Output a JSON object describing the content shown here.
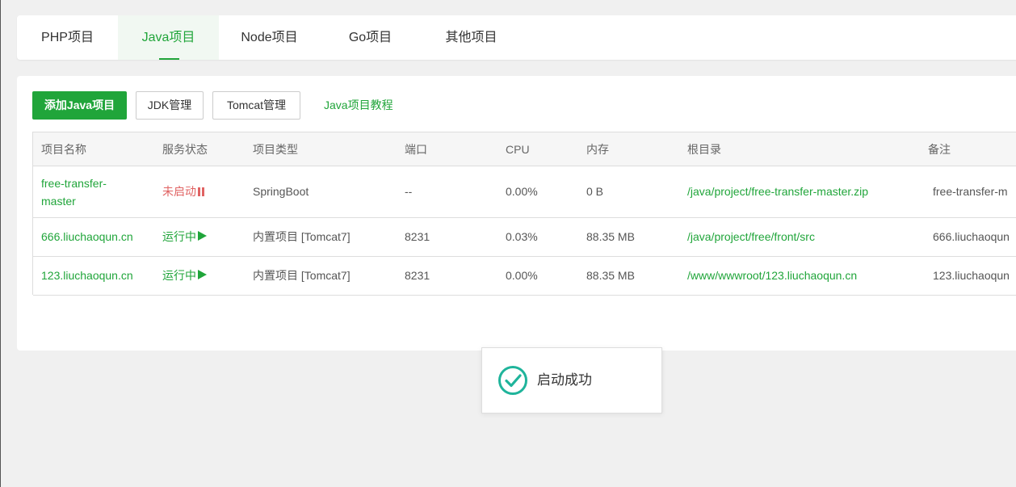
{
  "tabs": [
    {
      "label": "PHP项目",
      "active": false
    },
    {
      "label": "Java项目",
      "active": true
    },
    {
      "label": "Node项目",
      "active": false
    },
    {
      "label": "Go项目",
      "active": false
    },
    {
      "label": "其他项目",
      "active": false
    }
  ],
  "toolbar": {
    "add_label": "添加Java项目",
    "jdk_label": "JDK管理",
    "tomcat_label": "Tomcat管理",
    "tutorial_label": "Java项目教程"
  },
  "table": {
    "headers": [
      "项目名称",
      "服务状态",
      "项目类型",
      "端口",
      "CPU",
      "内存",
      "根目录",
      "备注"
    ],
    "rows": [
      {
        "name_line1": "free-transfer-",
        "name_line2": "master",
        "status": "未启动",
        "status_kind": "stopped",
        "type": "SpringBoot",
        "port": "--",
        "cpu": "0.00%",
        "memory": "0 B",
        "root": "/java/project/free-transfer-master.zip",
        "note": "free-transfer-m"
      },
      {
        "name": "666.liuchaoqun.cn",
        "status": "运行中",
        "status_kind": "running",
        "type": "内置项目 [Tomcat7]",
        "port": "8231",
        "cpu": "0.03%",
        "memory": "88.35 MB",
        "root": "/java/project/free/front/src",
        "note": "666.liuchaoqun"
      },
      {
        "name": "123.liuchaoqun.cn",
        "status": "运行中",
        "status_kind": "running",
        "type": "内置项目 [Tomcat7]",
        "port": "8231",
        "cpu": "0.00%",
        "memory": "88.35 MB",
        "root": "/www/wwwroot/123.liuchaoqun.cn",
        "note": "123.liuchaoqun"
      }
    ]
  },
  "toast": {
    "message": "启动成功",
    "icon": "check-circle-icon"
  },
  "colors": {
    "accent": "#20a53a",
    "stopped": "#e06363",
    "toast_icon": "#1fb49b"
  }
}
